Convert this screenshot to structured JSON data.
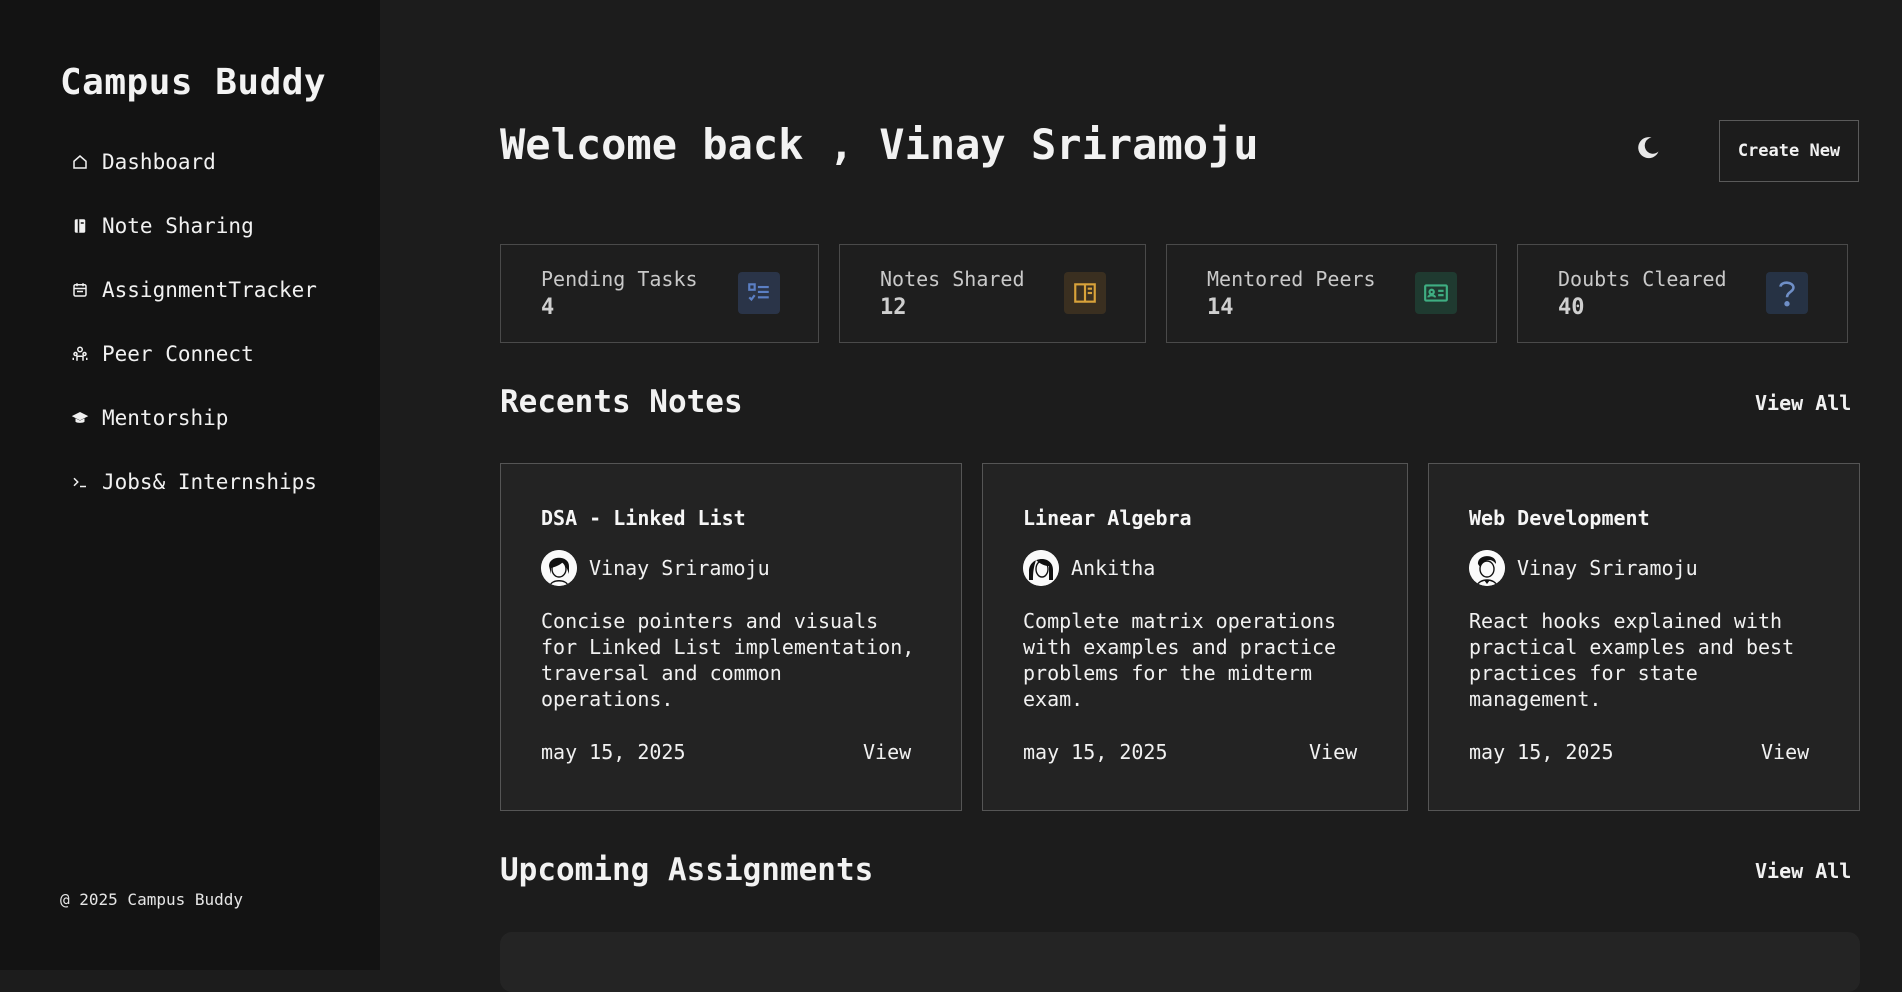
{
  "sidebar": {
    "brand": "Campus Buddy",
    "items": [
      {
        "label": "Dashboard",
        "icon": "home-icon"
      },
      {
        "label": "Note Sharing",
        "icon": "notebook-icon"
      },
      {
        "label": "AssignmentTracker",
        "icon": "calendar-icon"
      },
      {
        "label": "Peer Connect",
        "icon": "people-icon"
      },
      {
        "label": "Mentorship",
        "icon": "graduation-cap-icon"
      },
      {
        "label": "Jobs& Internships",
        "icon": "terminal-icon"
      }
    ],
    "footer": "@ 2025 Campus Buddy"
  },
  "header": {
    "welcome": "Welcome back , Vinay Sriramoju",
    "create_label": "Create New",
    "theme_icon": "moon-icon"
  },
  "stats": [
    {
      "label": "Pending Tasks",
      "value": "4",
      "icon": "checklist-icon",
      "icon_bg": "#2a3448",
      "icon_color": "#5b7fc4"
    },
    {
      "label": "Notes Shared",
      "value": "12",
      "icon": "book-icon",
      "icon_bg": "#3a2f20",
      "icon_color": "#d8a23a"
    },
    {
      "label": "Mentored Peers",
      "value": "14",
      "icon": "id-card-icon",
      "icon_bg": "#1f3a30",
      "icon_color": "#3fae82"
    },
    {
      "label": "Doubts Cleared",
      "value": "40",
      "icon": "question-icon",
      "icon_bg": "#263244",
      "icon_color": "#6f8fc7"
    }
  ],
  "recent_notes": {
    "title": "Recents Notes",
    "view_all": "View All",
    "cards": [
      {
        "title": "DSA - Linked List",
        "author": "Vinay Sriramoju",
        "desc_lines": [
          "Concise pointers and visuals",
          "for Linked List implementation,",
          "traversal and common",
          "operations."
        ],
        "date": "may 15, 2025",
        "view": "View"
      },
      {
        "title": "Linear Algebra",
        "author": "Ankitha",
        "desc_lines": [
          "Complete matrix operations",
          "with examples and practice",
          "problems for the midterm",
          "exam."
        ],
        "date": "may 15, 2025",
        "view": "View"
      },
      {
        "title": "Web Development",
        "author": "Vinay Sriramoju",
        "desc_lines": [
          "React hooks explained with",
          "practical examples and best",
          "practices for state",
          "management."
        ],
        "date": "may 15, 2025",
        "view": "View"
      }
    ]
  },
  "assignments": {
    "title": "Upcoming Assignments",
    "view_all": "View All"
  }
}
